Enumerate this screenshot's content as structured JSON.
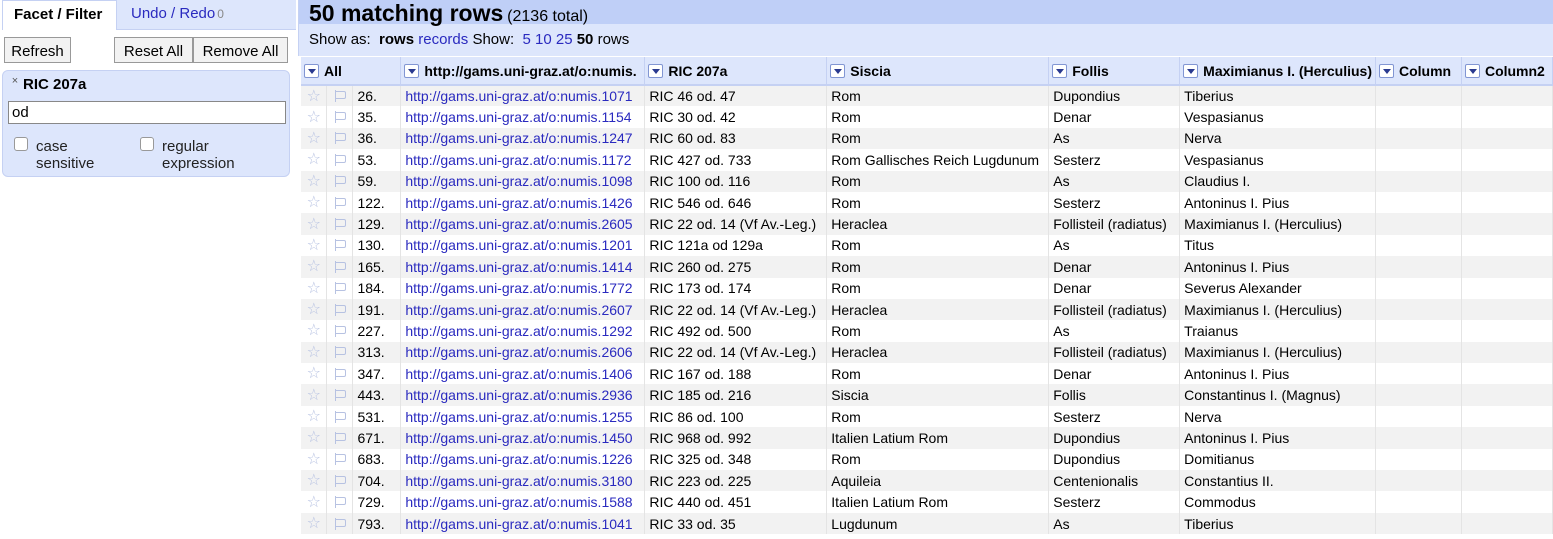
{
  "left_panel": {
    "tabs": {
      "facet_filter": "Facet / Filter",
      "undo_redo": "Undo / Redo",
      "undo_count": "0"
    },
    "buttons": {
      "refresh": "Refresh",
      "reset_all": "Reset All",
      "remove_all": "Remove All"
    },
    "facet": {
      "title": "RIC 207a",
      "close_icon": "×",
      "input_value": "od",
      "case_sensitive_label": "case sensitive",
      "case_line1": "case",
      "case_line2": "sensitive",
      "regex_line1": "regular",
      "regex_line2": "expression"
    }
  },
  "main": {
    "matching": "50 matching rows",
    "total": "(2136 total)",
    "show_as_label": "Show as:",
    "rows_option": "rows",
    "records_option": "records",
    "show_label": "Show:",
    "page_sizes": [
      "5",
      "10",
      "25",
      "50"
    ],
    "selected_page_size": "50",
    "rows_suffix": "rows",
    "columns": [
      "All",
      "http://gams.uni-graz.at/o:numis.",
      "RIC 207a",
      "Siscia",
      "Follis",
      "Maximianus I. (Herculius)",
      "Column",
      "Column2"
    ],
    "rows": [
      [
        "26.",
        "http://gams.uni-graz.at/o:numis.1071",
        "RIC 46 od. 47",
        "Rom",
        "Dupondius",
        "Tiberius"
      ],
      [
        "35.",
        "http://gams.uni-graz.at/o:numis.1154",
        "RIC 30 od. 42",
        "Rom",
        "Denar",
        "Vespasianus"
      ],
      [
        "36.",
        "http://gams.uni-graz.at/o:numis.1247",
        "RIC 60 od. 83",
        "Rom",
        "As",
        "Nerva"
      ],
      [
        "53.",
        "http://gams.uni-graz.at/o:numis.1172",
        "RIC 427 od. 733",
        "Rom Gallisches Reich Lugdunum",
        "Sesterz",
        "Vespasianus"
      ],
      [
        "59.",
        "http://gams.uni-graz.at/o:numis.1098",
        "RIC 100 od. 116",
        "Rom",
        "As",
        "Claudius I."
      ],
      [
        "122.",
        "http://gams.uni-graz.at/o:numis.1426",
        "RIC 546 od. 646",
        "Rom",
        "Sesterz",
        "Antoninus I. Pius"
      ],
      [
        "129.",
        "http://gams.uni-graz.at/o:numis.2605",
        "RIC 22 od. 14 (Vf Av.-Leg.)",
        "Heraclea",
        "Follisteil (radiatus)",
        "Maximianus I. (Herculius)"
      ],
      [
        "130.",
        "http://gams.uni-graz.at/o:numis.1201",
        "RIC 121a od 129a",
        "Rom",
        "As",
        "Titus"
      ],
      [
        "165.",
        "http://gams.uni-graz.at/o:numis.1414",
        "RIC 260 od. 275",
        "Rom",
        "Denar",
        "Antoninus I. Pius"
      ],
      [
        "184.",
        "http://gams.uni-graz.at/o:numis.1772",
        "RIC 173 od. 174",
        "Rom",
        "Denar",
        "Severus Alexander"
      ],
      [
        "191.",
        "http://gams.uni-graz.at/o:numis.2607",
        "RIC 22 od. 14 (Vf Av.-Leg.)",
        "Heraclea",
        "Follisteil (radiatus)",
        "Maximianus I. (Herculius)"
      ],
      [
        "227.",
        "http://gams.uni-graz.at/o:numis.1292",
        "RIC 492 od. 500",
        "Rom",
        "As",
        "Traianus"
      ],
      [
        "313.",
        "http://gams.uni-graz.at/o:numis.2606",
        "RIC 22 od. 14 (Vf Av.-Leg.)",
        "Heraclea",
        "Follisteil (radiatus)",
        "Maximianus I. (Herculius)"
      ],
      [
        "347.",
        "http://gams.uni-graz.at/o:numis.1406",
        "RIC 167 od. 188",
        "Rom",
        "Denar",
        "Antoninus I. Pius"
      ],
      [
        "443.",
        "http://gams.uni-graz.at/o:numis.2936",
        "RIC 185 od. 216",
        "Siscia",
        "Follis",
        "Constantinus I. (Magnus)"
      ],
      [
        "531.",
        "http://gams.uni-graz.at/o:numis.1255",
        "RIC 86 od. 100",
        "Rom",
        "Sesterz",
        "Nerva"
      ],
      [
        "671.",
        "http://gams.uni-graz.at/o:numis.1450",
        "RIC 968 od. 992",
        "Italien Latium Rom",
        "Dupondius",
        "Antoninus I. Pius"
      ],
      [
        "683.",
        "http://gams.uni-graz.at/o:numis.1226",
        "RIC 325 od. 348",
        "Rom",
        "Dupondius",
        "Domitianus"
      ],
      [
        "704.",
        "http://gams.uni-graz.at/o:numis.3180",
        "RIC 223 od. 225",
        "Aquileia",
        "Centenionalis",
        "Constantius II."
      ],
      [
        "729.",
        "http://gams.uni-graz.at/o:numis.1588",
        "RIC 440 od. 451",
        "Italien Latium Rom",
        "Sesterz",
        "Commodus"
      ],
      [
        "793.",
        "http://gams.uni-graz.at/o:numis.1041",
        "RIC 33 od. 35",
        "Lugdunum",
        "As",
        "Tiberius"
      ]
    ]
  }
}
